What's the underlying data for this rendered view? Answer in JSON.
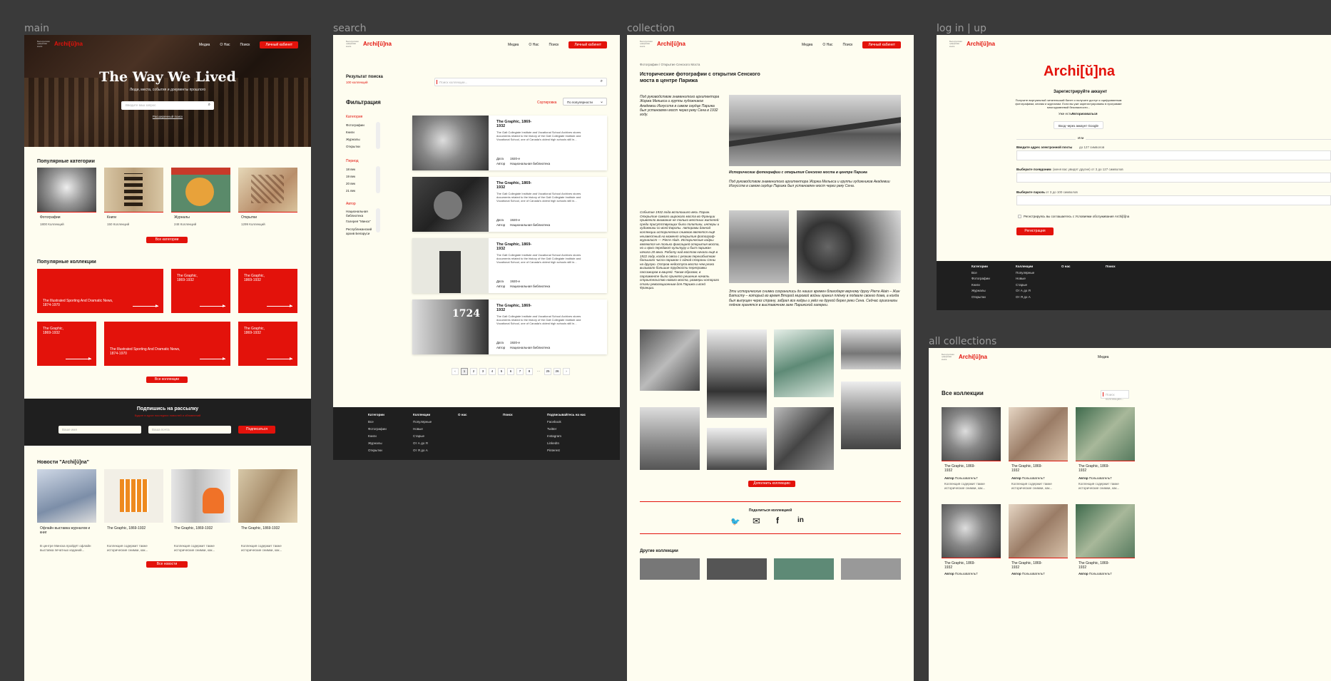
{
  "frames": {
    "main": "main",
    "search": "search",
    "collection": "collection",
    "login": "log in | up",
    "all": "all collections"
  },
  "header": {
    "logo_small": "Белорусская цифровая книга",
    "logo": "Archi[ŭ]na",
    "nav": [
      "Медиа",
      "О Нас",
      "Поиск"
    ],
    "cabinet": "Личный кабинет"
  },
  "main": {
    "hero_title": "The Way We Lived",
    "hero_sub": "Люди, места, события и документы прошлого",
    "search_placeholder": "Введите ваш запрос",
    "adv_search": "Расширенный поиск",
    "pop_cat_title": "Популярные категории",
    "categories": [
      {
        "name": "Фотографии",
        "count": "1800 Коллекций"
      },
      {
        "name": "Книги",
        "count": "150 Коллекций"
      },
      {
        "name": "Журналы",
        "count": "248 Коллекций"
      },
      {
        "name": "Открытки",
        "count": "1299 Коллекций"
      }
    ],
    "all_categories": "Все категории",
    "pop_col_title": "Популярные коллекции",
    "collections": [
      "The Illustrated Sporting And Dramatic News, 1874-1970",
      "The Graphic, 1869-1932",
      "The Graphic, 1869-1932",
      "The Graphic, 1869-1932",
      "The Illustrated Sporting And Dramatic News, 1874-1970",
      "The Graphic, 1869-1932"
    ],
    "all_collections": "Все коллекции",
    "subscribe_title": "Подпишись на рассылку",
    "subscribe_sub": "Будьте в курсе последних новостей и обновлений",
    "name_ph": "Ваше имя",
    "email_ph": "Ваша почта",
    "subscribe_btn": "Подписаться",
    "news_title": "Новости \"Archi[ŭ]na\"",
    "news": [
      {
        "title": "Офлайн выставка журналов и книг",
        "text": "В центре Минска пройдёт офлайн выставка печатных изданий..."
      },
      {
        "title": "The Graphic, 1869-1932",
        "text": "Коллекция содержит также исторические снимки, как..."
      },
      {
        "title": "The Graphic, 1869-1932",
        "text": "Коллекция содержит также исторические снимки, как..."
      },
      {
        "title": "The Graphic, 1869-1932",
        "text": "Коллекция содержит также исторические снимки, как..."
      }
    ],
    "all_news": "Все новости"
  },
  "search": {
    "results_title": "Результат поиска",
    "results_count": "100 коллекций",
    "search_ph": "Поиск коллекции...",
    "filter_title": "Фильтрация",
    "sort_label": "Сортировка",
    "sort_value": "По популярности",
    "groups": [
      {
        "title": "Категория",
        "items": [
          "Фотографии",
          "Книги",
          "Журналы",
          "Открытки"
        ]
      },
      {
        "title": "Период",
        "items": [
          "18 век",
          "19 век",
          "20 век",
          "21 век"
        ]
      },
      {
        "title": "Автор",
        "items": [
          "Национальная библиотека",
          "Галерея \"Минск\"",
          "Республиканский архив Беларуси"
        ]
      }
    ],
    "result_title": "The Graphic, 1869-1932",
    "result_desc": "The Galt Collegiate Institute and Vocational School Archives stores documents related to the history of the Galt Collegiate Institute and Vocational School, one of Canada's oldest high schools still in...",
    "date_label": "Дата",
    "date_value": "1920-е",
    "author_label": "Автор",
    "author_value": "Национальная библиотека",
    "pages": [
      "‹",
      "1",
      "2",
      "3",
      "4",
      "5",
      "6",
      "7",
      "8",
      "...",
      "25",
      "26",
      "›"
    ]
  },
  "footer": {
    "cols": [
      {
        "h": "Категории",
        "items": [
          "Все",
          "Фотографии",
          "Книги",
          "Журналы",
          "Открытки"
        ]
      },
      {
        "h": "Коллекции",
        "items": [
          "Популярные",
          "Новые",
          "Старые",
          "От А до Я",
          "От Я до А"
        ]
      },
      {
        "h": "О нас",
        "items": []
      },
      {
        "h": "Поиск",
        "items": []
      },
      {
        "h": "Подписывайтесь на нас",
        "items": [
          "Facebook",
          "Twitter",
          "Instagram",
          "LinkedIn",
          "Pinterest"
        ]
      }
    ]
  },
  "collection": {
    "breadcrumb": "Фотографии / Открытие Сенского Моста",
    "title": "Исторические фотографии с открытия Сенского моста в центре Парижа",
    "intro": "Под руководством знаменитого архитектора Жоржа Мельеса и группы художников Академии Искусств в самом сердце Парижа был установлен мост через реку Сена в 1932 году.",
    "caption_title": "Исторические фотографии с открытия Сенского моста в центре Парижа",
    "caption_text": "Под руководством знаменитого архитектора Жоржа Мельеса и группы художников Академии Искусств в самом сердце Парижа был установлен мост через реку Сена.",
    "long_text": "Событие 1932 года всполошило весь Париж. Открытие самого широкого моста во Франции привлекло внимание не только местных жителей: среди присутствующих были политики, интеры и художники со всей Европы. Авторами данной коллекции исторических снимков является ещё неизвестный на момент открытия фотограф-журналист — Pierre Alain. Исторические кадры являются не только фиксацией открытия моста, но и ярко передают культуру и быт парижан начала 20 века. Работу над мостом начали ещё в 1922 году, когда в связи с резким переизбытком большого числа парижан с одной стороны Сены на другую. Остров недоступа моста чем резко вызывало большие трудности переправки пассажиров в вацлей. Таким образом, в парламенте было принято решение начать строительство нового моста, размеры которого стали революционным для Парижа и всей Франции.",
    "photo_caption": "Эти исторические снимки сохранились до наших времен благодаря верному другу Pierre Alain – Жан Батисту – который во время Второй мировой войны хранил плёнку в подвале своего дома, а когда был выпущен через страну, забрал все кадры и увёз на другой берег реки Сена. Сейчас оригиналы плёнок хранятся в выставочном зале Парижской галереи.",
    "add_btn": "Дополнить коллекцию",
    "share": "Поделиться коллекцией",
    "other": "Другие коллекции"
  },
  "login": {
    "logo": "Archi[ŭ]na",
    "title": "Зарегистрируйте аккаунт",
    "desc": "Получите виртуальный читательский билет и получите доступ к оцифрованным фотографиям, книгам и журналам. Если вы уже зарегистрированы в программе многоуровневой безопасности...",
    "already": "Уже есть?",
    "auth": "Авторизоваться",
    "google": "Вход через аккаунт Google",
    "or": "Или",
    "email_label": "Введите адрес электронной почты",
    "email_hint": "до 127 символов",
    "nick_label": "Выберите псевдоним",
    "nick_hint": "(меня вас увидят другие) от 3 до 127 символов",
    "pass_label": "Выберите пароль",
    "pass_hint": "от 3 до 100 символов",
    "agree": "Регистрируясь вы соглашаетесь с Условиями обслуживания Archi[ŭ]na",
    "register": "Регистрация"
  },
  "all": {
    "title": "Все коллекции",
    "search_ph": "Поиск коллекции...",
    "card_title": "The Graphic, 1869-1932",
    "author_label": "Автор",
    "author_value": "Пользователь7",
    "card_text": "Коллекция содержит также исторические снимки, как..."
  },
  "colors": {
    "accent": "#e3120b",
    "paper": "#fefdf0",
    "dark": "#1f1f1f",
    "canvas": "#3a3a3a"
  }
}
